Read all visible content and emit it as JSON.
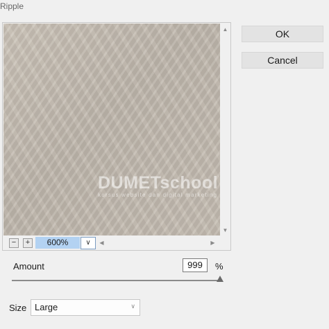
{
  "window": {
    "title": "Ripple"
  },
  "preview": {
    "watermark": {
      "logo_bold": "DUMET",
      "logo_rest": "school",
      "tagline": "kursus website dan digital marketing"
    },
    "zoom": {
      "out_label": "−",
      "in_label": "+",
      "value": "600%"
    }
  },
  "buttons": {
    "ok": "OK",
    "cancel": "Cancel"
  },
  "amount": {
    "label": "Amount",
    "value": "999",
    "unit": "%",
    "slider_fraction": 0.995
  },
  "size": {
    "label": "Size",
    "selected": "Large"
  },
  "colors": {
    "zoom_highlight": "#b3d2f2",
    "preview_texture": "#c4bcb1",
    "window_bg": "#f0f0f0"
  },
  "icons": {
    "scroll_up": "▲",
    "scroll_down": "▼",
    "scroll_left": "◀",
    "scroll_right": "▶",
    "dropdown": "∨"
  }
}
